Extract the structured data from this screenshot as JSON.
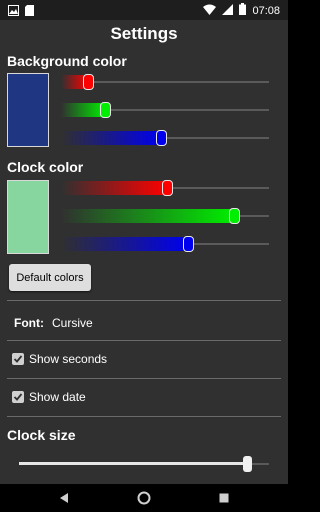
{
  "status_bar": {
    "time": "07:08",
    "icons": [
      "image-icon",
      "sd-card-icon",
      "wifi-icon",
      "cellular-icon",
      "battery-icon"
    ]
  },
  "page": {
    "title": "Settings"
  },
  "background_color": {
    "label": "Background color",
    "swatch": "#1f3682",
    "red": 0.13,
    "green": 0.21,
    "blue": 0.48
  },
  "clock_color": {
    "label": "Clock color",
    "swatch": "#87d6a0",
    "red": 0.51,
    "green": 0.83,
    "blue": 0.61
  },
  "default_colors_button": {
    "label": "Default colors"
  },
  "font": {
    "key": "Font:",
    "value": "Cursive"
  },
  "show_seconds": {
    "label": "Show seconds",
    "checked": true
  },
  "show_date": {
    "label": "Show date",
    "checked": true
  },
  "clock_size": {
    "label": "Clock size",
    "value": 0.91
  },
  "colors": {
    "red": "#ff0000",
    "green": "#00ee00",
    "blue": "#0000ee",
    "screen_bg": "#303030"
  },
  "nav_bar": {
    "buttons": [
      "back-icon",
      "home-icon",
      "recents-icon"
    ]
  }
}
